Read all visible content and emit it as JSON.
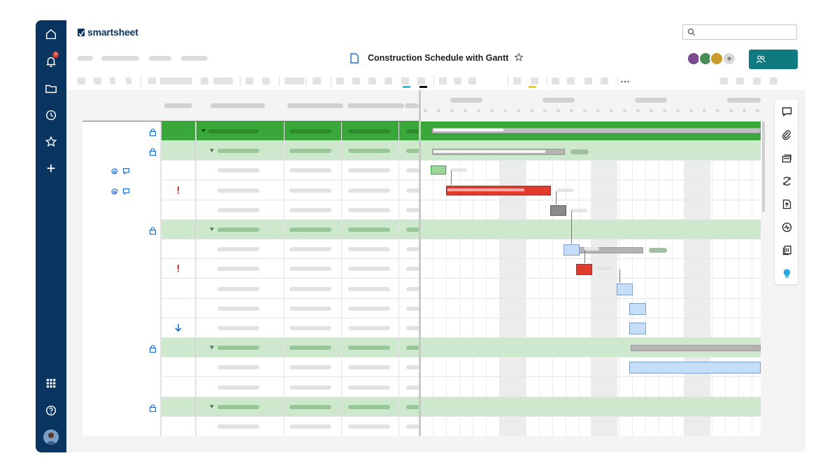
{
  "app": {
    "brand": "smartsheet",
    "notification_count": "3"
  },
  "sheet": {
    "title": "Construction Schedule with Gantt"
  },
  "icons": {
    "nav": [
      "home-icon",
      "bell-icon",
      "folder-icon",
      "clock-icon",
      "star-icon",
      "plus-icon",
      "apps-grid-icon",
      "help-icon"
    ],
    "right_panel": [
      "comment-icon",
      "attachment-icon",
      "proof-icon",
      "update-request-icon",
      "publish-icon",
      "activity-icon",
      "summary-icon",
      "bulb-icon"
    ]
  },
  "colors": {
    "nav_bg": "#0a3560",
    "share_button": "#0f7a80",
    "parent_row": "#cde8cd",
    "top_row": "#3aa73a",
    "critical_bar": "#e23b2e",
    "task_bar": "#c6ddf7",
    "flag_red": "#d9342b",
    "indicator_blue": "#1b6cd1"
  }
}
